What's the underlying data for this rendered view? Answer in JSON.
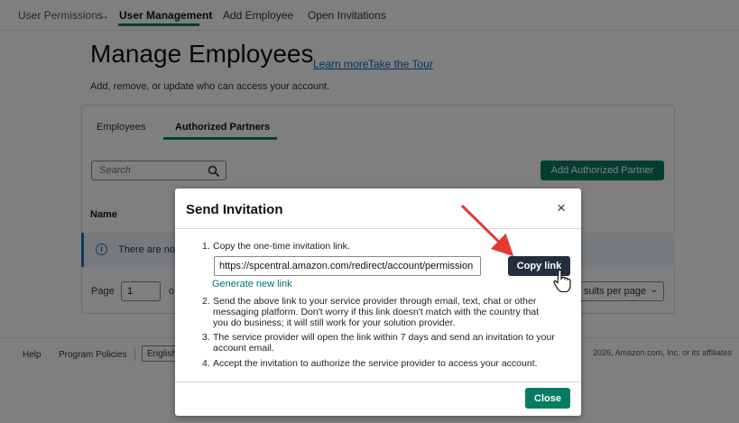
{
  "topnav": {
    "crumb": "User Permissions",
    "arrow": "→",
    "active": "User Management",
    "add_employee": "Add Employee",
    "open_invitations": "Open Invitations"
  },
  "header": {
    "title": "Manage Employees",
    "learn_more": "Learn more",
    "take_tour": "Take the Tour",
    "subtitle": "Add, remove, or update who can access your account."
  },
  "tabs": {
    "employees": "Employees",
    "authorized_partners": "Authorized Partners"
  },
  "search": {
    "placeholder": "Search"
  },
  "add_partner_label": "Add Authorized Partner",
  "table": {
    "col_name": "Name",
    "info_text": "There are no"
  },
  "pagination": {
    "page_label": "Page",
    "page_value": "1",
    "of_label": "o",
    "results_per_page": "sults per page"
  },
  "footer": {
    "help": "Help",
    "policies": "Program Policies",
    "language": "English",
    "copyright": "2026, Amazon.com, Inc. or its affiliates"
  },
  "modal": {
    "title": "Send Invitation",
    "close_glyph": "×",
    "steps": [
      {
        "num": "1.",
        "text": "Copy the one-time invitation link."
      },
      {
        "num": "2.",
        "lines": [
          "Send the above link to your service provider through email, text, chat or other",
          "messaging platform. Don't worry if this link doesn't match with the country that",
          "you do business; it will still work for your solution provider."
        ]
      },
      {
        "num": "3.",
        "lines": [
          "The service provider will open the link within 7 days and send an invitation to your",
          "account email."
        ]
      },
      {
        "num": "4.",
        "text": "Accept the invitation to authorize the service provider to access your account."
      }
    ],
    "link_value": "https://spcentral.amazon.com/redirect/account/permission",
    "copy_label": "Copy link",
    "generate_label": "Generate new link",
    "close_label": "Close"
  },
  "colors": {
    "accent": "#067d62",
    "dark_button": "#232f3e",
    "link": "#007185",
    "annotation_arrow": "#e53935"
  },
  "icons": {
    "search": "search-icon",
    "info": "info-icon",
    "close": "close-icon",
    "cursor": "hand-cursor-icon",
    "annotation": "red-arrow-annotation"
  }
}
